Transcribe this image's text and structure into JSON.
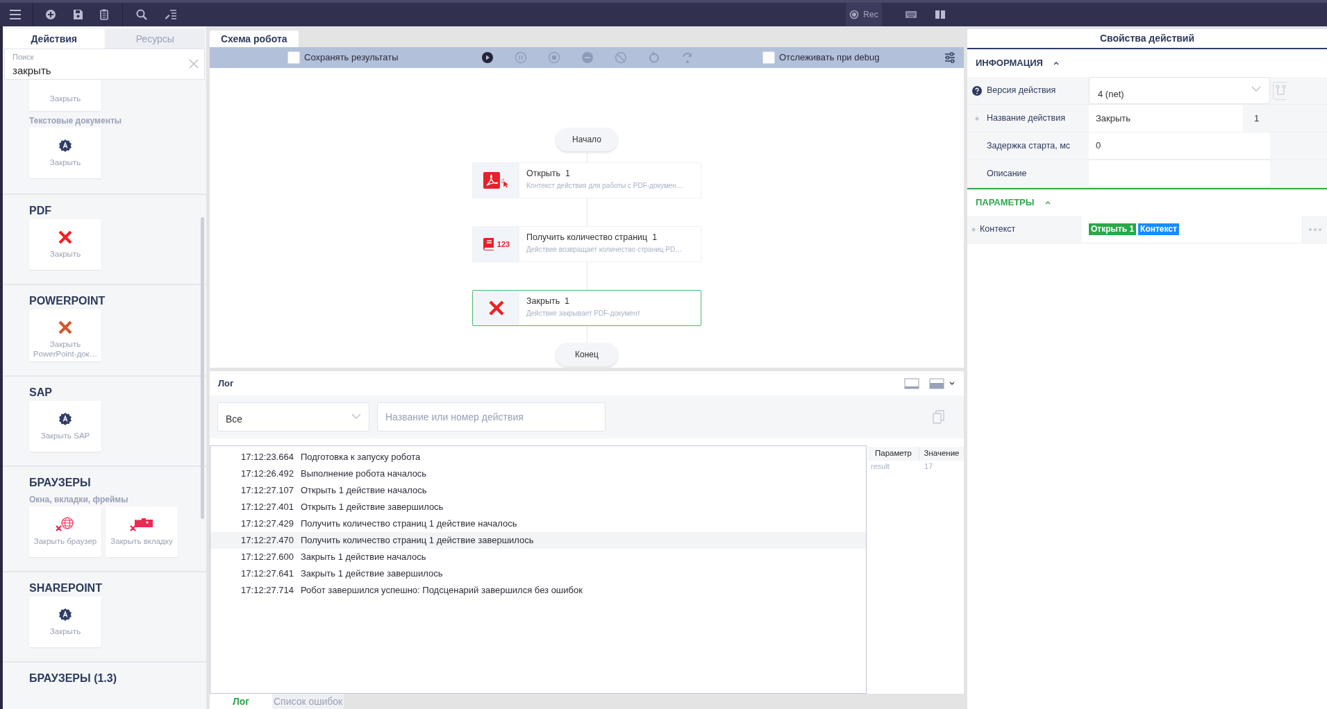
{
  "top_bar": {
    "rec_label": "Rec"
  },
  "left_panel": {
    "tabs": [
      {
        "label": "Действия",
        "selected": true
      },
      {
        "label": "Ресурсы",
        "selected": false
      }
    ],
    "search": {
      "placeholder": "Поиск",
      "value": "закрыть"
    },
    "sections": [
      {
        "blocks": [
          {
            "items": [
              {
                "label": "Закрыть",
                "kind": "partial"
              }
            ]
          },
          {
            "subtitle": "Текстовые документы",
            "items": [
              {
                "label": "Закрыть",
                "kind": "badge"
              }
            ]
          }
        ]
      },
      {
        "title": "PDF",
        "blocks": [
          {
            "items": [
              {
                "label": "Закрыть",
                "kind": "cross"
              }
            ]
          }
        ]
      },
      {
        "title": "POWERPOINT",
        "blocks": [
          {
            "items": [
              {
                "label": "Закрыть PowerPoint-док…",
                "kind": "slide-cross"
              }
            ]
          }
        ]
      },
      {
        "title": "SAP",
        "blocks": [
          {
            "items": [
              {
                "label": "Закрыть SAP",
                "kind": "badge"
              }
            ]
          }
        ]
      },
      {
        "title": "БРАУЗЕРЫ",
        "blocks": [
          {
            "subtitle": "Окна, вкладки, фреймы",
            "items": [
              {
                "label": "Закрыть браузер",
                "kind": "globe"
              },
              {
                "label": "Закрыть вкладку",
                "kind": "tab"
              }
            ]
          }
        ]
      },
      {
        "title": "SHAREPOINT",
        "blocks": [
          {
            "items": [
              {
                "label": "Закрыть",
                "kind": "badge"
              }
            ]
          }
        ]
      },
      {
        "title": "БРАУЗЕРЫ (1.3)"
      }
    ]
  },
  "schema": {
    "tab": {
      "label": "Схема робота",
      "selected": true
    },
    "save_results": {
      "label": "Сохранять результаты",
      "checked": false
    },
    "controls": [
      {
        "kind": "play",
        "disabled": false
      },
      {
        "kind": "pause",
        "disabled": true
      },
      {
        "kind": "stop",
        "disabled": true
      },
      {
        "kind": "minus",
        "disabled": true
      },
      {
        "kind": "ban",
        "disabled": true
      },
      {
        "kind": "undo",
        "disabled": true
      },
      {
        "kind": "redo",
        "disabled": true
      }
    ],
    "debug_tracking": {
      "label": "Отслеживать при debug",
      "checked": false
    },
    "flow": {
      "start": "Начало",
      "end": "Конец",
      "nodes": [
        {
          "kind": "pdf",
          "title": "Открыть  1",
          "description": "Контекст действия для работы с PDF-докумен…",
          "selected": false
        },
        {
          "kind": "book",
          "icon_text": "123",
          "title": "Получить количество страниц  1",
          "description": "Действие возвращает количество страниц PD…",
          "selected": false
        },
        {
          "kind": "cross",
          "title": "Закрыть  1",
          "description": "Действие закрывает PDF-документ",
          "selected": true
        }
      ]
    }
  },
  "log": {
    "title": "Лог",
    "filter": {
      "value": "Все"
    },
    "search": {
      "placeholder": "Название или номер действия"
    },
    "entries": [
      {
        "time": "17:12:23.664",
        "message": "Подготовка к запуску робота",
        "selected": false
      },
      {
        "time": "17:12:26.492",
        "message": "Выполнение робота началось",
        "selected": false
      },
      {
        "time": "17:12:27.107",
        "message": "Открыть 1 действие началось",
        "selected": false
      },
      {
        "time": "17:12:27.401",
        "message": "Открыть 1 действие завершилось",
        "selected": false
      },
      {
        "time": "17:12:27.429",
        "message": "Получить количество страниц 1 действие началось",
        "selected": false
      },
      {
        "time": "17:12:27.470",
        "message": "Получить количество страниц 1 действие завершилось",
        "selected": true
      },
      {
        "time": "17:12:27.600",
        "message": "Закрыть 1 действие началось",
        "selected": false
      },
      {
        "time": "17:12:27.641",
        "message": "Закрыть 1 действие завершилось",
        "selected": false
      },
      {
        "time": "17:12:27.714",
        "message": "Робот завершился успешно: Подсценарий завершился без ошибок",
        "selected": false
      }
    ],
    "params": {
      "columns": [
        "Параметр",
        "Значение"
      ],
      "rows": [
        [
          "result",
          "17"
        ]
      ]
    },
    "tabs": [
      {
        "label": "Лог",
        "selected": true
      },
      {
        "label": "Список ошибок",
        "selected": false
      }
    ]
  },
  "properties": {
    "title": "Свойства действий",
    "sections": [
      {
        "title": "ИНФОРМАЦИЯ",
        "color": "#2c3a5c",
        "expanded": true,
        "rows": [
          {
            "kind": "select",
            "label": "Версия действия",
            "help": true,
            "required": false,
            "value": "4 (net)"
          },
          {
            "kind": "counter",
            "label": "Название действия",
            "help": false,
            "required": true,
            "value": "Закрыть",
            "counter": "1"
          },
          {
            "kind": "text",
            "label": "Задержка старта, мс",
            "help": false,
            "required": false,
            "value": "0"
          },
          {
            "kind": "text",
            "label": "Описание",
            "help": false,
            "required": false
          }
        ]
      },
      {
        "title": "ПАРАМЕТРЫ",
        "color": "#2aa84a",
        "expanded": true,
        "rows": [
          {
            "kind": "tokens",
            "label": "Контекст",
            "help": false,
            "required": true,
            "tokens": [
              {
                "text": "Открыть 1",
                "color": "#2aa84a"
              },
              {
                "text": "Контекст",
                "color": "#1a8cff"
              }
            ]
          }
        ]
      }
    ]
  }
}
